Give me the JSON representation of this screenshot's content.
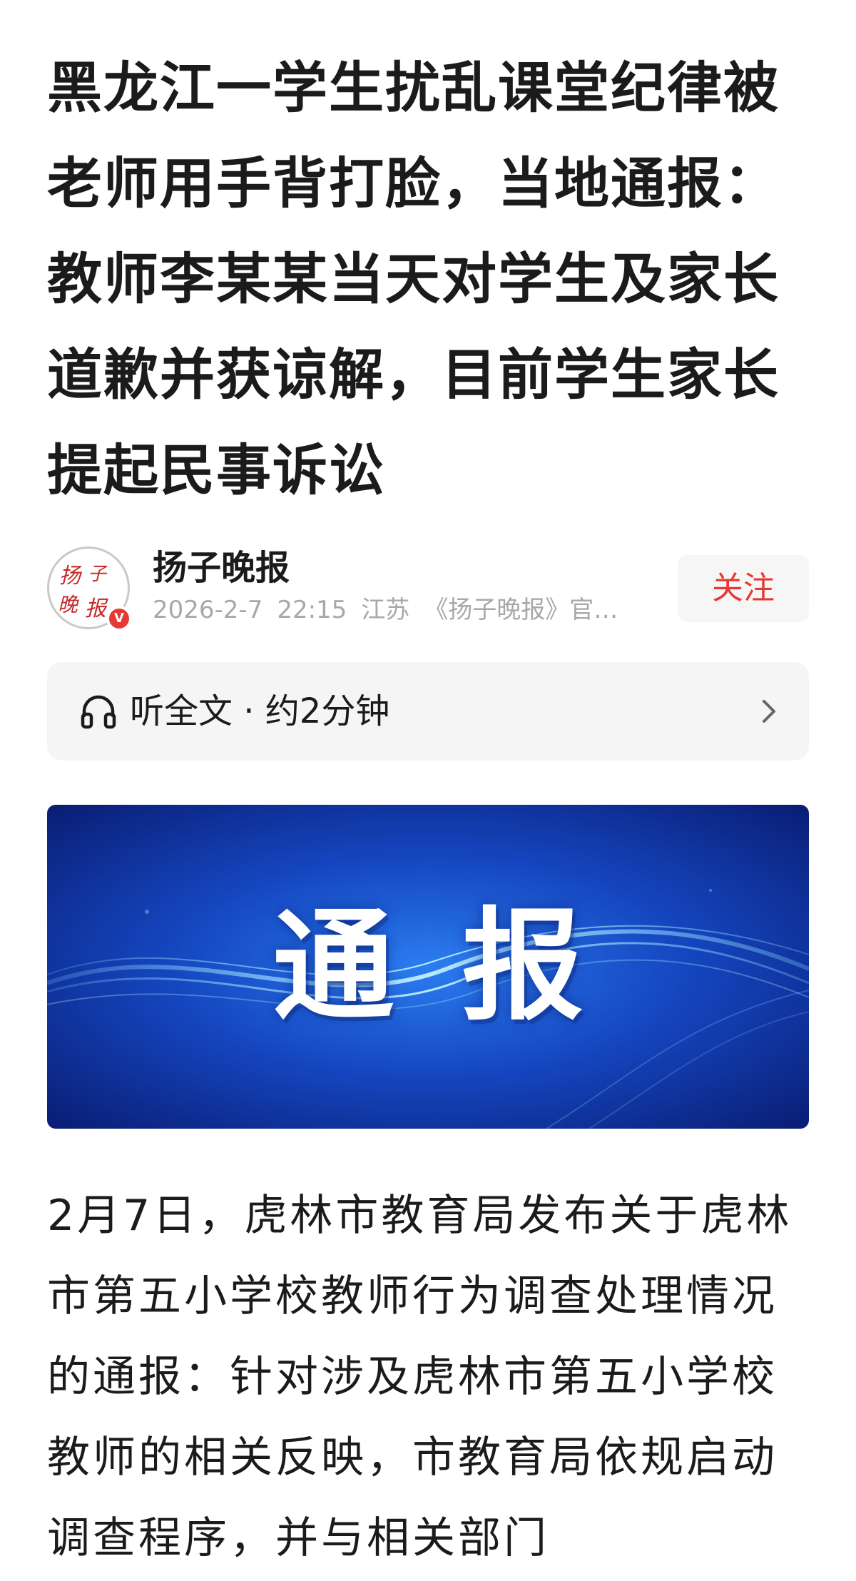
{
  "article": {
    "headline": "黑龙江一学生扰乱课堂纪律被老师用手背打脸，当地通报：教师李某某当天对学生及家长道歉并获谅解，目前学生家长提起民事诉讼"
  },
  "author": {
    "name": "扬子晚报",
    "avatar_text": "扬子晚报",
    "verified_badge": "V",
    "date": "2026-2-7",
    "time": "22:15",
    "location": "江苏",
    "description": "《扬子晚报》官…",
    "follow_label": "关注"
  },
  "listen": {
    "label": "听全文 · 约2分钟",
    "icon": "headphones-icon",
    "chevron_icon": "chevron-right-icon"
  },
  "banner": {
    "title": "通报"
  },
  "body": {
    "paragraph": "2月7日，虎林市教育局发布关于虎林市第五小学校教师行为调查处理情况的通报：针对涉及虎林市第五小学校教师的相关反映，市教育局依规启动调查程序，并与相关部门"
  },
  "colors": {
    "accent": "#e53935",
    "text": "#1b1b1b",
    "meta": "#a8a8a8",
    "panel": "#f5f5f5",
    "banner_dark": "#0a1f7a",
    "banner_light": "#1f6fe0"
  }
}
